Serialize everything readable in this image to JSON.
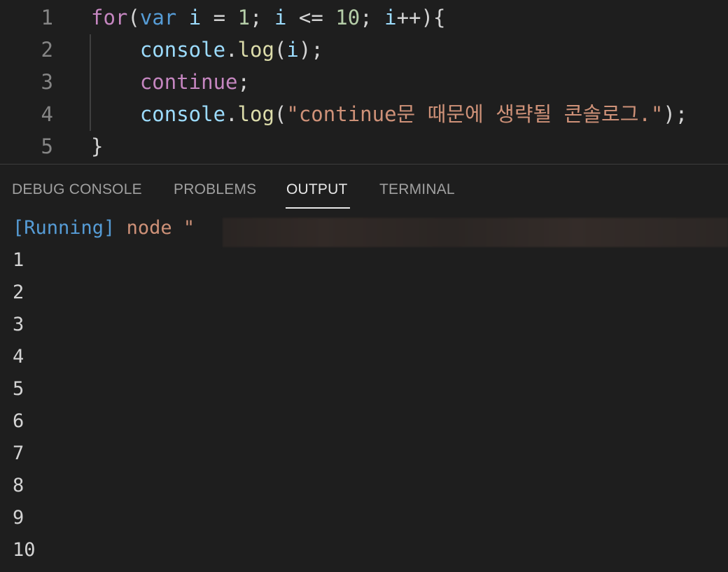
{
  "editor": {
    "lines": [
      {
        "number": "1",
        "tokens": [
          {
            "t": "for",
            "c": "kw-purple"
          },
          {
            "t": "(",
            "c": "punc"
          },
          {
            "t": "var",
            "c": "kw-blue"
          },
          {
            "t": " ",
            "c": "punc"
          },
          {
            "t": "i",
            "c": "ident"
          },
          {
            "t": " = ",
            "c": "punc"
          },
          {
            "t": "1",
            "c": "num"
          },
          {
            "t": "; ",
            "c": "punc"
          },
          {
            "t": "i",
            "c": "ident"
          },
          {
            "t": " <= ",
            "c": "punc"
          },
          {
            "t": "10",
            "c": "num"
          },
          {
            "t": "; ",
            "c": "punc"
          },
          {
            "t": "i",
            "c": "ident"
          },
          {
            "t": "++){",
            "c": "punc"
          }
        ]
      },
      {
        "number": "2",
        "tokens": [
          {
            "t": "    ",
            "c": "punc"
          },
          {
            "t": "console",
            "c": "obj"
          },
          {
            "t": ".",
            "c": "punc"
          },
          {
            "t": "log",
            "c": "fn"
          },
          {
            "t": "(",
            "c": "punc"
          },
          {
            "t": "i",
            "c": "ident"
          },
          {
            "t": ");",
            "c": "punc"
          }
        ]
      },
      {
        "number": "3",
        "tokens": [
          {
            "t": "    ",
            "c": "punc"
          },
          {
            "t": "continue",
            "c": "kw-purple"
          },
          {
            "t": ";",
            "c": "punc"
          }
        ]
      },
      {
        "number": "4",
        "tokens": [
          {
            "t": "    ",
            "c": "punc"
          },
          {
            "t": "console",
            "c": "obj"
          },
          {
            "t": ".",
            "c": "punc"
          },
          {
            "t": "log",
            "c": "fn"
          },
          {
            "t": "(",
            "c": "punc"
          },
          {
            "t": "\"continue문 때문에 생략될 콘솔로그.\"",
            "c": "str"
          },
          {
            "t": ");",
            "c": "punc"
          }
        ]
      },
      {
        "number": "5",
        "tokens": [
          {
            "t": "}",
            "c": "punc"
          }
        ]
      }
    ]
  },
  "panel": {
    "tabs": [
      {
        "label": "DEBUG CONSOLE",
        "active": false
      },
      {
        "label": "PROBLEMS",
        "active": false
      },
      {
        "label": "OUTPUT",
        "active": true
      },
      {
        "label": "TERMINAL",
        "active": false
      }
    ],
    "output": {
      "running_tag": "[Running]",
      "running_cmd": " node \"",
      "lines": [
        "1",
        "2",
        "3",
        "4",
        "5",
        "6",
        "7",
        "8",
        "9",
        "10"
      ]
    }
  },
  "colors": {
    "background": "#1e1e1e",
    "keyword_purple": "#c586c0",
    "keyword_blue": "#569cd6",
    "identifier": "#9cdcfe",
    "number": "#b5cea8",
    "function": "#dcdcaa",
    "string": "#ce9178"
  }
}
